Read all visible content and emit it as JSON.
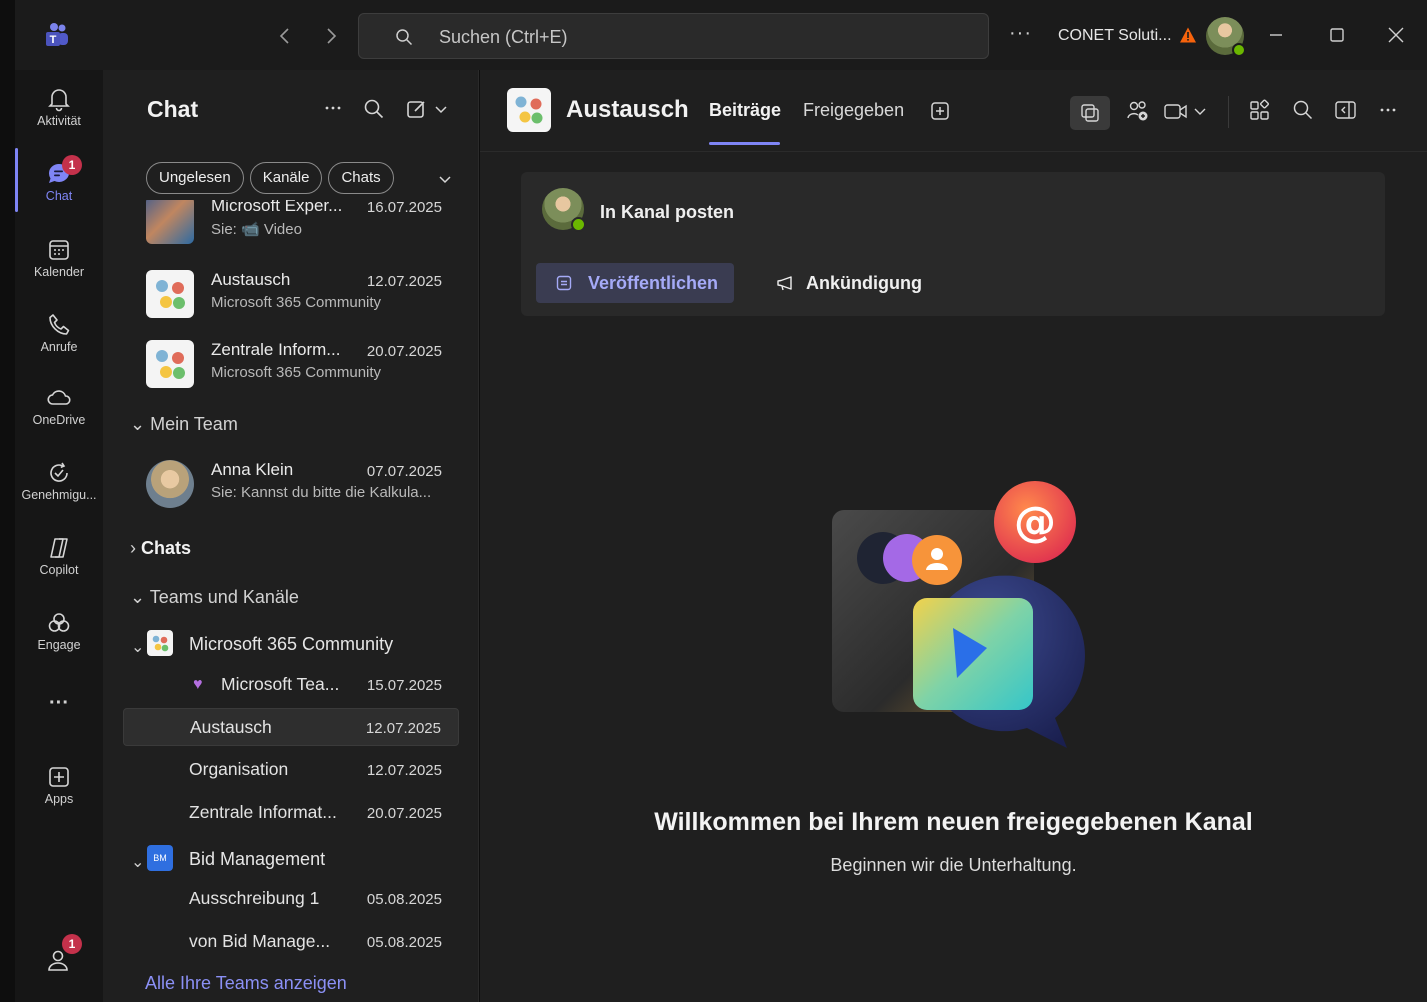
{
  "titlebar": {
    "search_placeholder": "Suchen (Ctrl+E)",
    "more": "···",
    "org": "CONET Soluti..."
  },
  "rail": {
    "items": [
      {
        "label": "Aktivität"
      },
      {
        "label": "Chat",
        "badge": "1"
      },
      {
        "label": "Kalender"
      },
      {
        "label": "Anrufe"
      },
      {
        "label": "OneDrive"
      },
      {
        "label": "Genehmigu..."
      },
      {
        "label": "Copilot"
      },
      {
        "label": "Engage"
      },
      {
        "label": "···"
      },
      {
        "label": "Apps"
      }
    ],
    "bottom_badge": "1"
  },
  "pane": {
    "title": "Chat",
    "chips": [
      "Ungelesen",
      "Kanäle",
      "Chats"
    ],
    "recent": [
      {
        "name": "Microsoft Exper...",
        "date": "16.07.2025",
        "sub": "Sie: 📹 Video"
      },
      {
        "name": "Austausch",
        "date": "12.07.2025",
        "sub": "Microsoft 365 Community"
      },
      {
        "name": "Zentrale Inform...",
        "date": "20.07.2025",
        "sub": "Microsoft 365 Community"
      }
    ],
    "mein_team": {
      "header": "Mein Team",
      "items": [
        {
          "name": "Anna Klein",
          "date": "07.07.2025",
          "sub": "Sie: Kannst du bitte die Kalkula..."
        }
      ]
    },
    "chats_header": "Chats",
    "teams_header": "Teams und Kanäle",
    "teams": [
      {
        "name": "Microsoft 365 Community",
        "channels": [
          {
            "name": "Microsoft Tea...",
            "date": "15.07.2025"
          },
          {
            "name": "Austausch",
            "date": "12.07.2025"
          },
          {
            "name": "Organisation",
            "date": "12.07.2025"
          },
          {
            "name": "Zentrale Informat...",
            "date": "20.07.2025"
          }
        ]
      },
      {
        "name": "Bid Management",
        "icon_text": "BM",
        "channels": [
          {
            "name": "Ausschreibung 1",
            "date": "05.08.2025"
          },
          {
            "name": "von Bid Manage...",
            "date": "05.08.2025"
          }
        ]
      }
    ],
    "all_teams": "Alle Ihre Teams anzeigen"
  },
  "main": {
    "title": "Austausch",
    "tabs": [
      "Beiträge",
      "Freigegeben"
    ],
    "post_card": {
      "title": "In Kanal posten",
      "publish": "Veröffentlichen",
      "announce": "Ankündigung"
    },
    "welcome_title": "Willkommen bei Ihrem neuen freigegebenen Kanal",
    "welcome_sub": "Beginnen wir die Unterhaltung."
  },
  "colors": {
    "accent": "#7f85f5",
    "badge": "#c4314b",
    "presence": "#6bb700",
    "bid_management": "#2f6fe0"
  }
}
